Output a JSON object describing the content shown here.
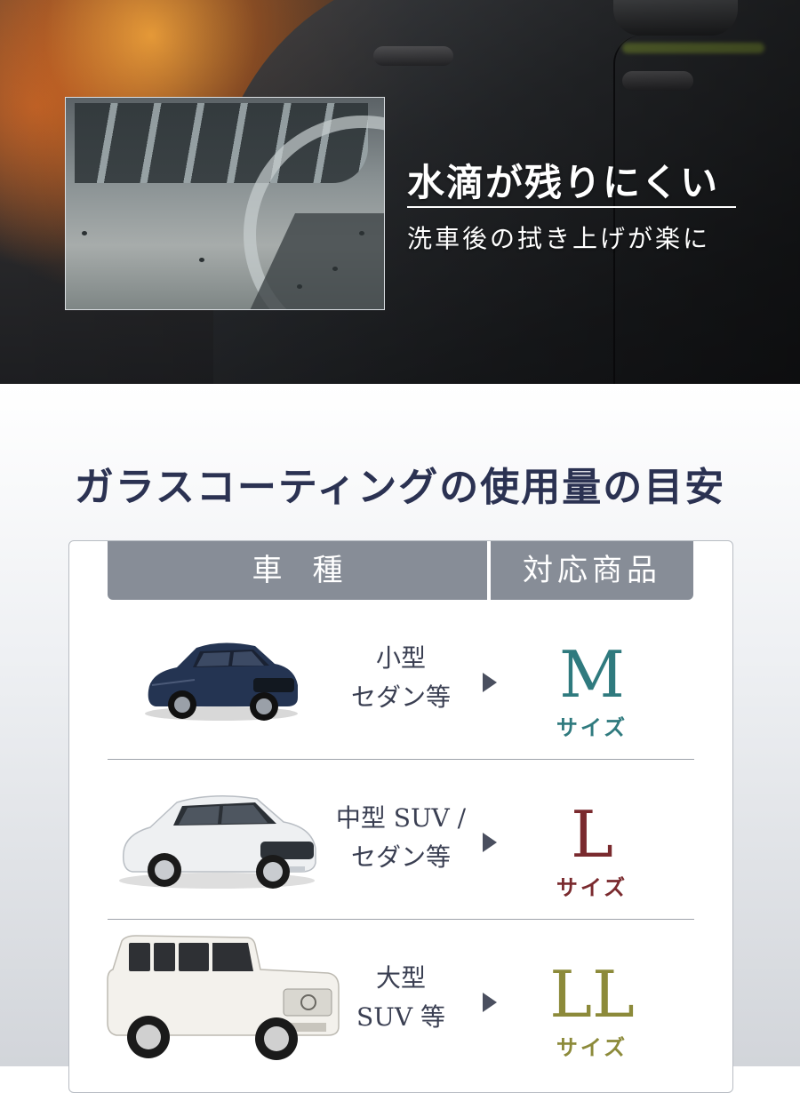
{
  "hero": {
    "title": "水滴が残りにくい",
    "subtitle": "洗車後の拭き上げが楽に"
  },
  "section": {
    "title": "ガラスコーティングの使用量の目安"
  },
  "table": {
    "headers": {
      "car_type": "車種",
      "product": "対応商品"
    },
    "rows": [
      {
        "car_label_line1": "小型",
        "car_label_line2": "セダン等",
        "size": "M",
        "size_word": "サイズ",
        "color": "#2f7a7e",
        "car_icon": "sedan-car-icon"
      },
      {
        "car_label_line1": "中型 SUV /",
        "car_label_line2": "セダン等",
        "size": "L",
        "size_word": "サイズ",
        "color": "#7a2a2e",
        "car_icon": "mid-suv-car-icon"
      },
      {
        "car_label_line1": "大型",
        "car_label_line2": "SUV 等",
        "size": "LL",
        "size_word": "サイズ",
        "color": "#8c8a3a",
        "car_icon": "large-suv-car-icon"
      }
    ]
  }
}
